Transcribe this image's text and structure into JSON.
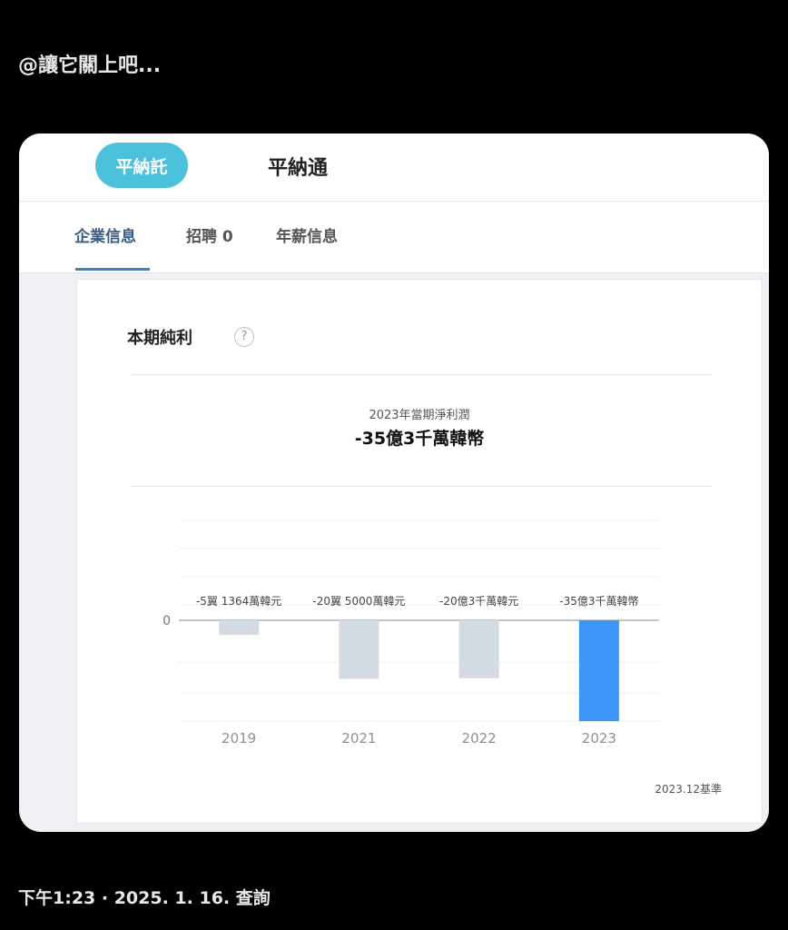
{
  "post": {
    "title": "@讓它關上吧...",
    "timestamp": "下午1:23 · 2025. 1. 16. 查詢"
  },
  "company": {
    "logo_text": "平納託",
    "name": "平納通"
  },
  "tabs": [
    {
      "label": "企業信息",
      "active": true
    },
    {
      "label": "招聘 0",
      "active": false
    },
    {
      "label": "年薪信息",
      "active": false
    }
  ],
  "panel": {
    "title": "本期純利",
    "help_icon": "question-circle-icon",
    "summary_label": "2023年當期淨利潤",
    "summary_value": "-35億3千萬韓幣",
    "basis": "2023.12基準"
  },
  "colors": {
    "accent": "#3f7ec0",
    "logo": "#4cc1dc",
    "bar_highlight": "#3d95f5",
    "bar_default": "#d5dbe3"
  },
  "chart_data": {
    "type": "bar",
    "categories": [
      "2019",
      "2021",
      "2022",
      "2023"
    ],
    "values": [
      -5.1364,
      -20.5,
      -20.3,
      -35.3
    ],
    "data_labels": [
      "-5翼 1364萬韓元",
      "-20翼 5000萬韓元",
      "-20億3千萬韓元",
      "-35億3千萬韓幣"
    ],
    "y_tick_labels": [
      "0"
    ],
    "ylim": [
      -35.3,
      30
    ],
    "highlight_index": 3,
    "grid": true
  }
}
